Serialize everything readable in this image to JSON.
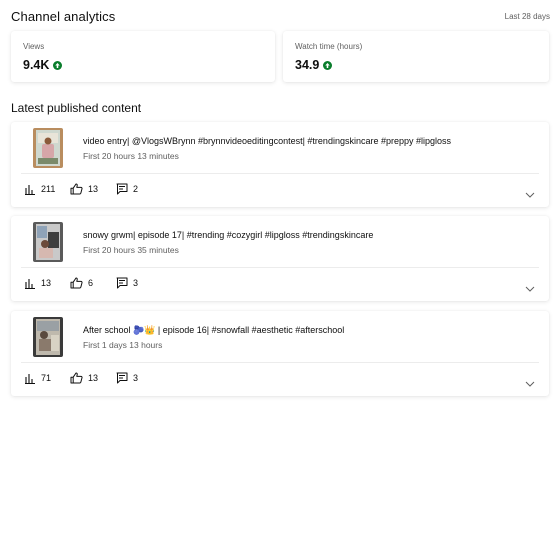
{
  "header": {
    "title": "Channel analytics",
    "period": "Last 28 days"
  },
  "stats": [
    {
      "label": "Views",
      "value": "9.4K",
      "trend": "up"
    },
    {
      "label": "Watch time (hours)",
      "value": "34.9",
      "trend": "up"
    }
  ],
  "section_title": "Latest published content",
  "videos": [
    {
      "title": "video entry| @VlogsWBrynn #brynnvideoeditingcontest| #trendingskincare #preppy #lipgloss",
      "time": "First 20 hours 13 minutes",
      "views": "211",
      "likes": "13",
      "comments": "2"
    },
    {
      "title": "snowy grwm| episode 17| #trending #cozygirl #lipgloss #trendingskincare",
      "time": "First 20 hours 35 minutes",
      "views": "13",
      "likes": "6",
      "comments": "3"
    },
    {
      "title": "After school 🫐👑 | episode 16| #snowfall #aesthetic #afterschool",
      "time": "First 1 days 13 hours",
      "views": "71",
      "likes": "13",
      "comments": "3"
    }
  ],
  "colors": {
    "trend_up": "#0a7d2c",
    "text_secondary": "#606060"
  }
}
